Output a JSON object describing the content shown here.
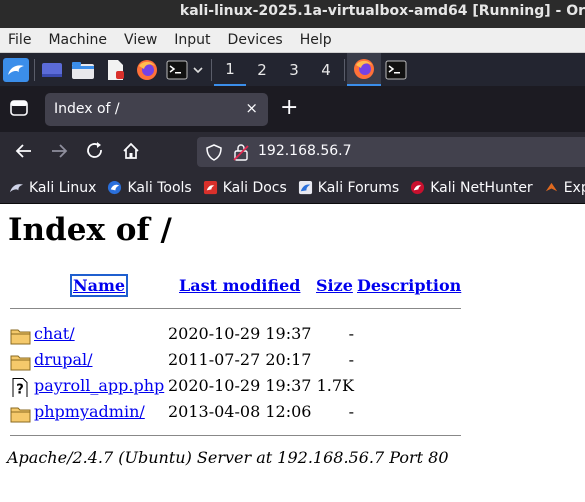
{
  "vbox": {
    "title": "kali-linux-2025.1a-virtualbox-amd64 [Running] - Or",
    "menu": [
      "File",
      "Machine",
      "View",
      "Input",
      "Devices",
      "Help"
    ]
  },
  "panel": {
    "workspaces": [
      "1",
      "2",
      "3",
      "4"
    ]
  },
  "browser": {
    "tab_title": "Index of /",
    "tab_close": "×",
    "new_tab": "+",
    "url": "192.168.56.7",
    "bookmarks": [
      "Kali Linux",
      "Kali Tools",
      "Kali Docs",
      "Kali Forums",
      "Kali NetHunter",
      "Exploi"
    ]
  },
  "page": {
    "heading": "Index of /",
    "columns": {
      "name": "Name",
      "modified": "Last modified",
      "size": "Size",
      "description": "Description"
    },
    "rows": [
      {
        "name": "chat/",
        "modified": "2020-10-29 19:37",
        "size": "-",
        "icon": "folder-icon"
      },
      {
        "name": "drupal/",
        "modified": "2011-07-27 20:17",
        "size": "-",
        "icon": "folder-icon"
      },
      {
        "name": "payroll_app.php",
        "modified": "2020-10-29 19:37",
        "size": "1.7K",
        "icon": "unknown-file-icon"
      },
      {
        "name": "phpmyadmin/",
        "modified": "2013-04-08 12:06",
        "size": "-",
        "icon": "folder-icon"
      }
    ],
    "footer": "Apache/2.4.7 (Ubuntu) Server at 192.168.56.7 Port 80"
  },
  "colors": {
    "link": "#0000ee",
    "kali_panel": "#232530",
    "firefox_toolbar": "#2b2a33",
    "firefox_tabstrip": "#1c1b22"
  }
}
